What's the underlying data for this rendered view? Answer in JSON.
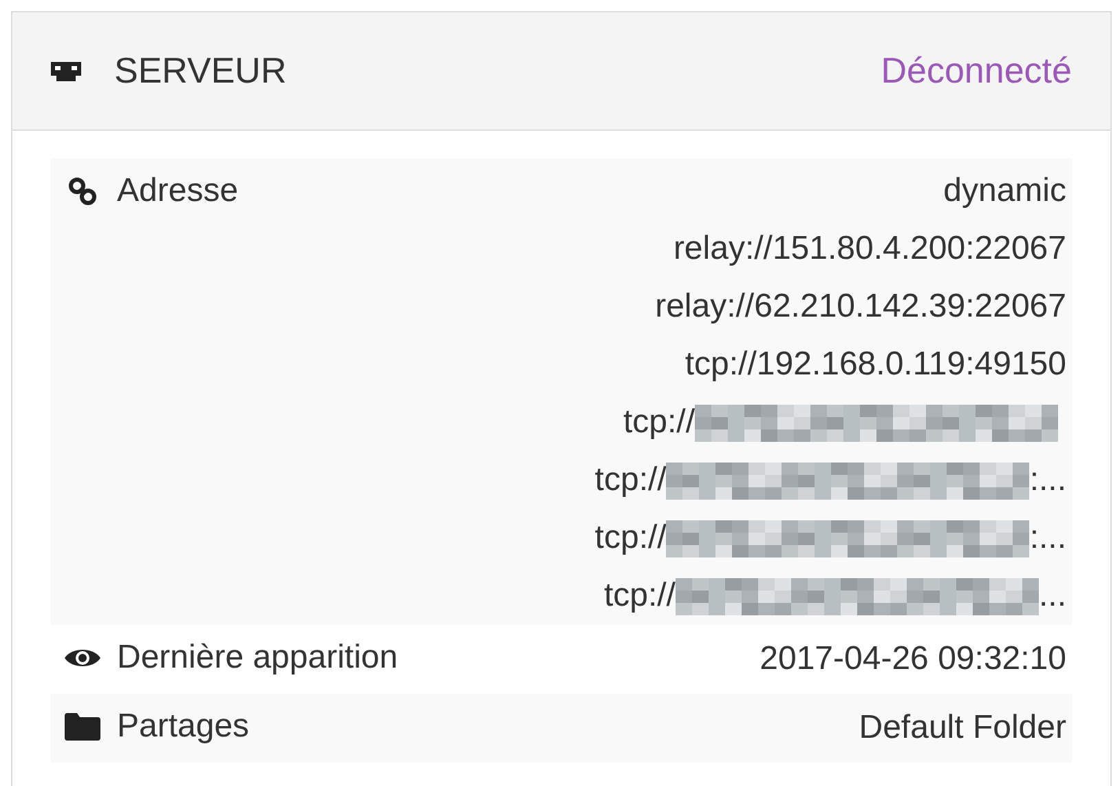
{
  "panel": {
    "title": "SERVEUR",
    "status": "Déconnecté"
  },
  "rows": [
    {
      "kind": "addresses",
      "label": "Adresse",
      "values": [
        {
          "kind": "plain",
          "text": "dynamic"
        },
        {
          "kind": "plain",
          "text": "relay://151.80.4.200:22067"
        },
        {
          "kind": "plain",
          "text": "relay://62.210.142.39:22067"
        },
        {
          "kind": "plain",
          "text": "tcp://192.168.0.119:49150"
        },
        {
          "kind": "redacted",
          "prefix": "tcp://"
        },
        {
          "kind": "redacted",
          "prefix": "tcp://",
          "suffix": ":..."
        },
        {
          "kind": "redacted",
          "prefix": "tcp://",
          "suffix": ":..."
        },
        {
          "kind": "redacted",
          "prefix": "tcp://",
          "suffix": "..."
        }
      ]
    },
    {
      "kind": "seen",
      "label": "Dernière apparition",
      "value": "2017-04-26 09:32:10"
    },
    {
      "kind": "shares",
      "label": "Partages",
      "value": "Default Folder"
    }
  ]
}
